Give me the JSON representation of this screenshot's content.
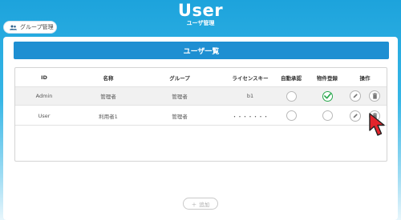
{
  "header": {
    "title": "User",
    "subtitle": "ユーザ管理"
  },
  "group_button": {
    "label": "グループ管理",
    "icon": "people-icon"
  },
  "panel": {
    "title": "ユーザ一覧"
  },
  "table": {
    "columns": [
      "ID",
      "名称",
      "グループ",
      "ライセンスキー",
      "自動承認",
      "物件登録",
      "操作"
    ],
    "rows": [
      {
        "id": "Admin",
        "name": "管理者",
        "group": "管理者",
        "license_key": "b1",
        "auto_approve": false,
        "property_registration": true
      },
      {
        "id": "User",
        "name": "利用者1",
        "group": "管理者",
        "license_key": "・・・・・・・",
        "auto_approve": false,
        "property_registration": false
      }
    ]
  },
  "add_button": {
    "label": "追加",
    "icon": "plus-icon"
  },
  "colors": {
    "accent": "#1e8fd2",
    "check": "#29a84d",
    "cursor": "#e3242b"
  }
}
